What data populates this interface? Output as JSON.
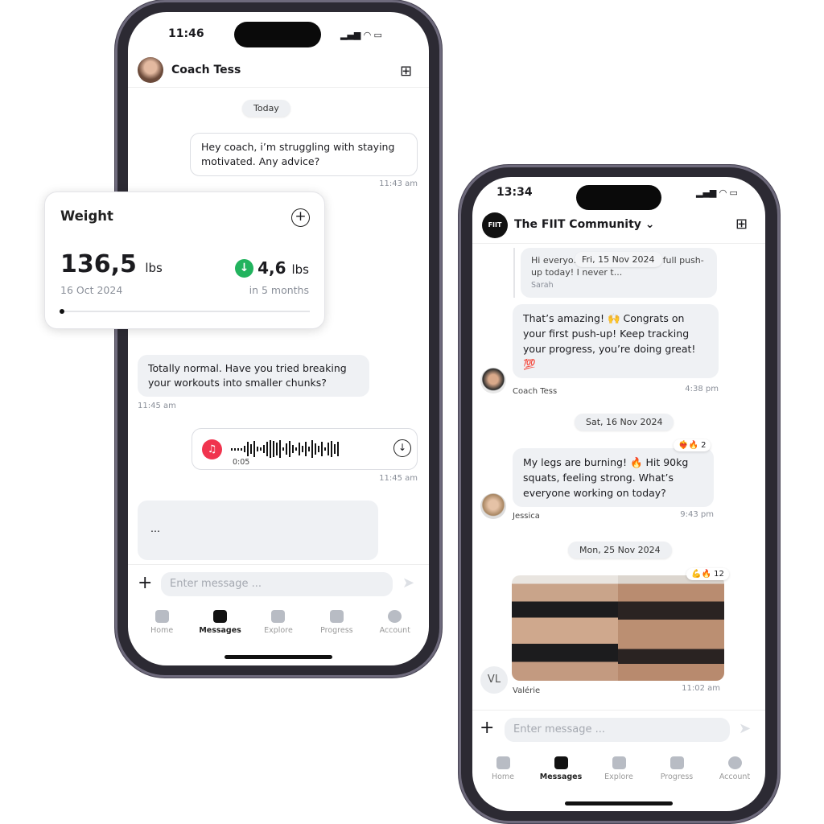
{
  "phone1": {
    "status_time": "11:46",
    "chat_title": "Coach Tess",
    "date_chip": "Today",
    "messages": [
      {
        "text": "Hey coach, i’m struggling with staying motivated. Any advice?",
        "time": "11:43 am"
      },
      {
        "text": "Totally normal. Have you tried breaking your workouts into smaller chunks?",
        "time": "11:45 am"
      },
      {
        "voice_duration": "0:05",
        "time": "11:45 am"
      },
      {
        "text": "..."
      }
    ],
    "input_placeholder": "Enter message ...",
    "nav": [
      "Home",
      "Messages",
      "Explore",
      "Progress",
      "Account"
    ],
    "active_nav": "Messages"
  },
  "weight_card": {
    "title": "Weight",
    "value": "136,5",
    "unit": "lbs",
    "date": "16 Oct 2024",
    "change": "4,6",
    "change_unit": "lbs",
    "period": "in 5 months",
    "accent": "#22b35e"
  },
  "phone2": {
    "status_time": "13:34",
    "chat_title": "The FIIT Community",
    "logo_text": "FIIT",
    "quote": {
      "text": "Hi everyo… I just did my first full push-up today! I never t...",
      "author": "Sarah",
      "chip": "Fri, 15 Nov 2024"
    },
    "messages": [
      {
        "text": "That’s amazing! 🙌 Congrats on your first push-up! Keep tracking your progress, you’re doing great! 💯",
        "author": "Coach Tess",
        "time": "4:38 pm"
      },
      {
        "date_chip": "Sat, 16 Nov 2024"
      },
      {
        "text": "My legs are burning! 🔥 Hit 90kg squats, feeling strong. What’s everyone working on today?",
        "author": "Jessica",
        "time": "9:43 pm",
        "reactions": "❤️‍🔥🔥",
        "reaction_count": "2"
      },
      {
        "date_chip": "Mon, 25 Nov 2024"
      },
      {
        "image": "before-after-photo",
        "author": "Valérie",
        "initials": "VL",
        "time": "11:02 am",
        "reactions": "💪🔥",
        "reaction_count": "12"
      }
    ],
    "input_placeholder": "Enter message ...",
    "nav": [
      "Home",
      "Messages",
      "Explore",
      "Progress",
      "Account"
    ],
    "active_nav": "Messages"
  }
}
